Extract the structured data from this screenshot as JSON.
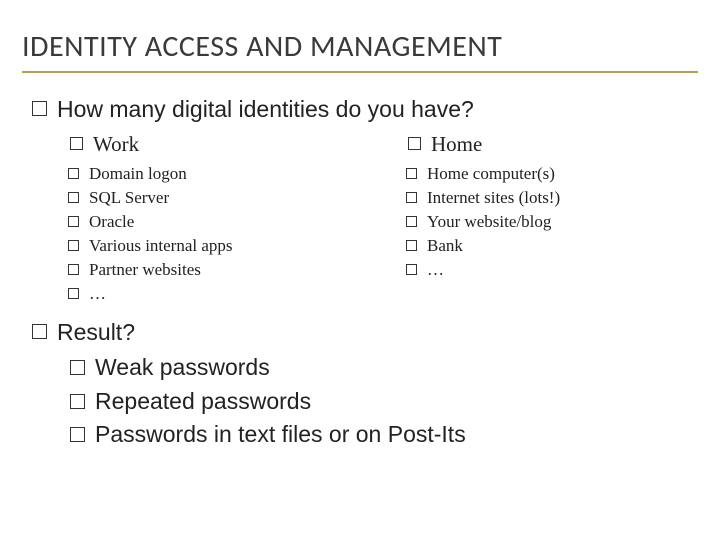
{
  "title": "IDENTITY ACCESS AND MANAGEMENT",
  "q1": "How many digital identities do you have?",
  "work": {
    "heading": "Work",
    "items": [
      "Domain logon",
      "SQL Server",
      "Oracle",
      "Various internal apps",
      "Partner websites",
      "…"
    ]
  },
  "home": {
    "heading": "Home",
    "items": [
      "Home computer(s)",
      "Internet sites (lots!)",
      "Your website/blog",
      "Bank",
      "…"
    ]
  },
  "result": {
    "heading": "Result?",
    "items": [
      "Weak passwords",
      "Repeated passwords",
      "Passwords in text files or on Post-Its"
    ]
  }
}
